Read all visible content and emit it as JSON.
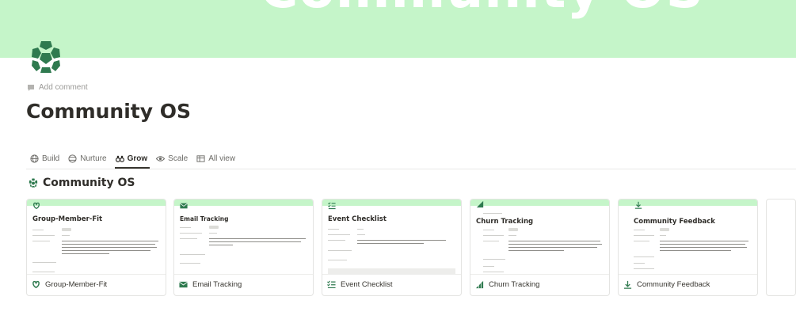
{
  "cover": {
    "text": "Community OS",
    "color": "#c5f5c9"
  },
  "page": {
    "icon": "soccer-ball-icon",
    "add_comment": "Add comment",
    "title": "Community OS"
  },
  "tabs": [
    {
      "label": "Build",
      "icon": "globe-icon",
      "active": false
    },
    {
      "label": "Nurture",
      "icon": "globe-lines-icon",
      "active": false
    },
    {
      "label": "Grow",
      "icon": "binoculars-icon",
      "active": true
    },
    {
      "label": "Scale",
      "icon": "eye-icon",
      "active": false
    },
    {
      "label": "All view",
      "icon": "table-icon",
      "active": false
    }
  ],
  "section": {
    "title": "Community OS",
    "icon": "soccer-ball-icon"
  },
  "cards": [
    {
      "title": "Group-Member-Fit",
      "icon": "pretzel-icon"
    },
    {
      "title": "Email Tracking",
      "icon": "envelope-icon"
    },
    {
      "title": "Event Checklist",
      "icon": "checklist-icon"
    },
    {
      "title": "Churn Tracking",
      "icon": "chart-icon"
    },
    {
      "title": "Community Feedback",
      "icon": "download-icon"
    }
  ],
  "colors": {
    "accent": "#2f7a4f",
    "cover": "#c5f5c9",
    "text": "#37352f",
    "muted": "#9b9a97"
  }
}
